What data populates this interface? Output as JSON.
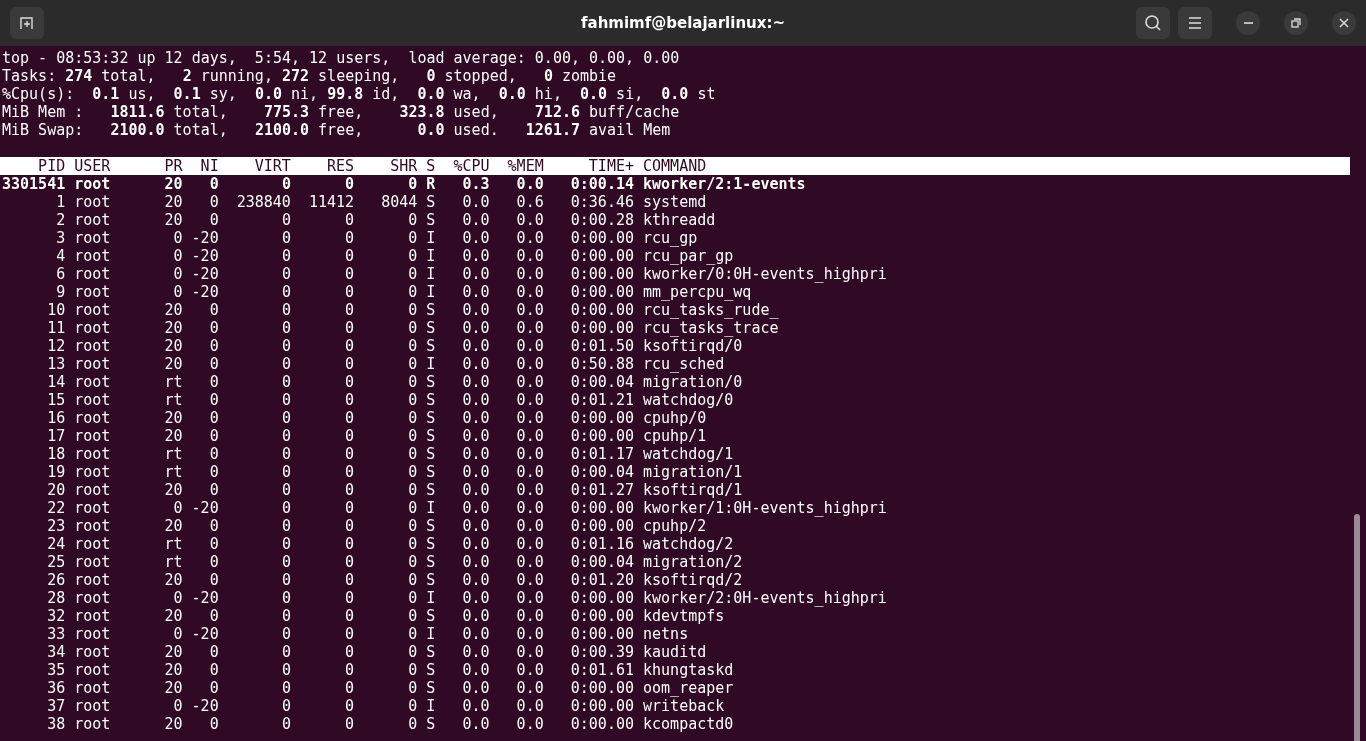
{
  "window": {
    "title": "fahmimf@belajarlinux:~"
  },
  "summary": [
    "top - 08:53:32 up 12 days,  5:54, 12 users,  load average: 0.00, 0.00, 0.00",
    "Tasks: **274** total,   **2** running, **272** sleeping,   **0** stopped,   **0** zombie",
    "%Cpu(s):  **0.1** us,  **0.1** sy,  **0.0** ni, **99.8** id,  **0.0** wa,  **0.0** hi,  **0.0** si,  **0.0** st",
    "MiB Mem :   **1811.6** total,    **775.3** free,    **323.8** used,    **712.6** buff/cache",
    "MiB Swap:   **2100.0** total,   **2100.0** free,      **0.0** used.   **1261.7** avail Mem"
  ],
  "table": {
    "columns": [
      "PID",
      "USER",
      "PR",
      "NI",
      "VIRT",
      "RES",
      "SHR",
      "S",
      "%CPU",
      "%MEM",
      "TIME+",
      "COMMAND"
    ],
    "rows": [
      {
        "highlighted": true,
        "cells": [
          "3301541",
          "root",
          "20",
          "0",
          "0",
          "0",
          "0",
          "R",
          "0.3",
          "0.0",
          "0:00.14",
          "kworker/2:1-events"
        ]
      },
      {
        "highlighted": false,
        "cells": [
          "1",
          "root",
          "20",
          "0",
          "238840",
          "11412",
          "8044",
          "S",
          "0.0",
          "0.6",
          "0:36.46",
          "systemd"
        ]
      },
      {
        "highlighted": false,
        "cells": [
          "2",
          "root",
          "20",
          "0",
          "0",
          "0",
          "0",
          "S",
          "0.0",
          "0.0",
          "0:00.28",
          "kthreadd"
        ]
      },
      {
        "highlighted": false,
        "cells": [
          "3",
          "root",
          "0",
          "-20",
          "0",
          "0",
          "0",
          "I",
          "0.0",
          "0.0",
          "0:00.00",
          "rcu_gp"
        ]
      },
      {
        "highlighted": false,
        "cells": [
          "4",
          "root",
          "0",
          "-20",
          "0",
          "0",
          "0",
          "I",
          "0.0",
          "0.0",
          "0:00.00",
          "rcu_par_gp"
        ]
      },
      {
        "highlighted": false,
        "cells": [
          "6",
          "root",
          "0",
          "-20",
          "0",
          "0",
          "0",
          "I",
          "0.0",
          "0.0",
          "0:00.00",
          "kworker/0:0H-events_highpri"
        ]
      },
      {
        "highlighted": false,
        "cells": [
          "9",
          "root",
          "0",
          "-20",
          "0",
          "0",
          "0",
          "I",
          "0.0",
          "0.0",
          "0:00.00",
          "mm_percpu_wq"
        ]
      },
      {
        "highlighted": false,
        "cells": [
          "10",
          "root",
          "20",
          "0",
          "0",
          "0",
          "0",
          "S",
          "0.0",
          "0.0",
          "0:00.00",
          "rcu_tasks_rude_"
        ]
      },
      {
        "highlighted": false,
        "cells": [
          "11",
          "root",
          "20",
          "0",
          "0",
          "0",
          "0",
          "S",
          "0.0",
          "0.0",
          "0:00.00",
          "rcu_tasks_trace"
        ]
      },
      {
        "highlighted": false,
        "cells": [
          "12",
          "root",
          "20",
          "0",
          "0",
          "0",
          "0",
          "S",
          "0.0",
          "0.0",
          "0:01.50",
          "ksoftirqd/0"
        ]
      },
      {
        "highlighted": false,
        "cells": [
          "13",
          "root",
          "20",
          "0",
          "0",
          "0",
          "0",
          "I",
          "0.0",
          "0.0",
          "0:50.88",
          "rcu_sched"
        ]
      },
      {
        "highlighted": false,
        "cells": [
          "14",
          "root",
          "rt",
          "0",
          "0",
          "0",
          "0",
          "S",
          "0.0",
          "0.0",
          "0:00.04",
          "migration/0"
        ]
      },
      {
        "highlighted": false,
        "cells": [
          "15",
          "root",
          "rt",
          "0",
          "0",
          "0",
          "0",
          "S",
          "0.0",
          "0.0",
          "0:01.21",
          "watchdog/0"
        ]
      },
      {
        "highlighted": false,
        "cells": [
          "16",
          "root",
          "20",
          "0",
          "0",
          "0",
          "0",
          "S",
          "0.0",
          "0.0",
          "0:00.00",
          "cpuhp/0"
        ]
      },
      {
        "highlighted": false,
        "cells": [
          "17",
          "root",
          "20",
          "0",
          "0",
          "0",
          "0",
          "S",
          "0.0",
          "0.0",
          "0:00.00",
          "cpuhp/1"
        ]
      },
      {
        "highlighted": false,
        "cells": [
          "18",
          "root",
          "rt",
          "0",
          "0",
          "0",
          "0",
          "S",
          "0.0",
          "0.0",
          "0:01.17",
          "watchdog/1"
        ]
      },
      {
        "highlighted": false,
        "cells": [
          "19",
          "root",
          "rt",
          "0",
          "0",
          "0",
          "0",
          "S",
          "0.0",
          "0.0",
          "0:00.04",
          "migration/1"
        ]
      },
      {
        "highlighted": false,
        "cells": [
          "20",
          "root",
          "20",
          "0",
          "0",
          "0",
          "0",
          "S",
          "0.0",
          "0.0",
          "0:01.27",
          "ksoftirqd/1"
        ]
      },
      {
        "highlighted": false,
        "cells": [
          "22",
          "root",
          "0",
          "-20",
          "0",
          "0",
          "0",
          "I",
          "0.0",
          "0.0",
          "0:00.00",
          "kworker/1:0H-events_highpri"
        ]
      },
      {
        "highlighted": false,
        "cells": [
          "23",
          "root",
          "20",
          "0",
          "0",
          "0",
          "0",
          "S",
          "0.0",
          "0.0",
          "0:00.00",
          "cpuhp/2"
        ]
      },
      {
        "highlighted": false,
        "cells": [
          "24",
          "root",
          "rt",
          "0",
          "0",
          "0",
          "0",
          "S",
          "0.0",
          "0.0",
          "0:01.16",
          "watchdog/2"
        ]
      },
      {
        "highlighted": false,
        "cells": [
          "25",
          "root",
          "rt",
          "0",
          "0",
          "0",
          "0",
          "S",
          "0.0",
          "0.0",
          "0:00.04",
          "migration/2"
        ]
      },
      {
        "highlighted": false,
        "cells": [
          "26",
          "root",
          "20",
          "0",
          "0",
          "0",
          "0",
          "S",
          "0.0",
          "0.0",
          "0:01.20",
          "ksoftirqd/2"
        ]
      },
      {
        "highlighted": false,
        "cells": [
          "28",
          "root",
          "0",
          "-20",
          "0",
          "0",
          "0",
          "I",
          "0.0",
          "0.0",
          "0:00.00",
          "kworker/2:0H-events_highpri"
        ]
      },
      {
        "highlighted": false,
        "cells": [
          "32",
          "root",
          "20",
          "0",
          "0",
          "0",
          "0",
          "S",
          "0.0",
          "0.0",
          "0:00.00",
          "kdevtmpfs"
        ]
      },
      {
        "highlighted": false,
        "cells": [
          "33",
          "root",
          "0",
          "-20",
          "0",
          "0",
          "0",
          "I",
          "0.0",
          "0.0",
          "0:00.00",
          "netns"
        ]
      },
      {
        "highlighted": false,
        "cells": [
          "34",
          "root",
          "20",
          "0",
          "0",
          "0",
          "0",
          "S",
          "0.0",
          "0.0",
          "0:00.39",
          "kauditd"
        ]
      },
      {
        "highlighted": false,
        "cells": [
          "35",
          "root",
          "20",
          "0",
          "0",
          "0",
          "0",
          "S",
          "0.0",
          "0.0",
          "0:01.61",
          "khungtaskd"
        ]
      },
      {
        "highlighted": false,
        "cells": [
          "36",
          "root",
          "20",
          "0",
          "0",
          "0",
          "0",
          "S",
          "0.0",
          "0.0",
          "0:00.00",
          "oom_reaper"
        ]
      },
      {
        "highlighted": false,
        "cells": [
          "37",
          "root",
          "0",
          "-20",
          "0",
          "0",
          "0",
          "I",
          "0.0",
          "0.0",
          "0:00.00",
          "writeback"
        ]
      },
      {
        "highlighted": false,
        "cells": [
          "38",
          "root",
          "20",
          "0",
          "0",
          "0",
          "0",
          "S",
          "0.0",
          "0.0",
          "0:00.00",
          "kcompactd0"
        ]
      }
    ]
  }
}
